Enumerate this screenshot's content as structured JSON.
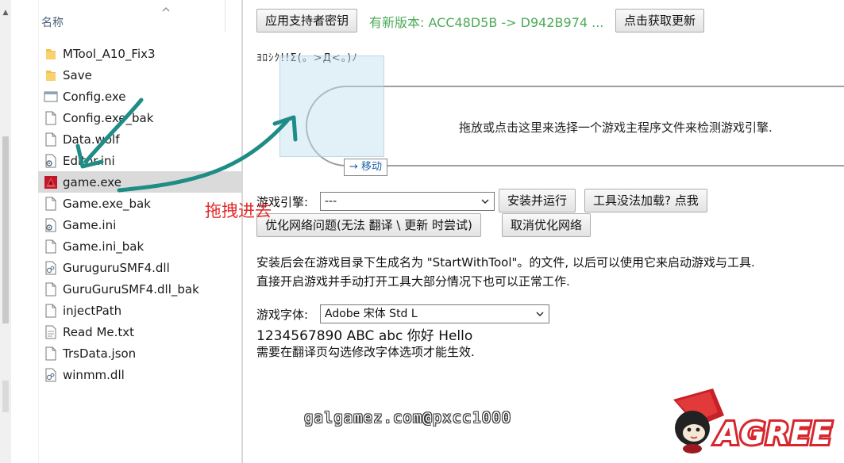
{
  "explorer": {
    "column_header": "名称",
    "files": [
      {
        "name": "MTool_A10_Fix3",
        "icon": "folder-icon"
      },
      {
        "name": "Save",
        "icon": "folder-icon"
      },
      {
        "name": "Config.exe",
        "icon": "app-window-icon"
      },
      {
        "name": "Config.exe_bak",
        "icon": "file-icon"
      },
      {
        "name": "Data.wolf",
        "icon": "file-icon"
      },
      {
        "name": "Editor.ini",
        "icon": "settings-file-icon"
      },
      {
        "name": "game.exe",
        "icon": "game-exe-icon",
        "selected": true
      },
      {
        "name": "Game.exe_bak",
        "icon": "file-icon"
      },
      {
        "name": "Game.ini",
        "icon": "settings-file-icon"
      },
      {
        "name": "Game.ini_bak",
        "icon": "file-icon"
      },
      {
        "name": "GuruguruSMF4.dll",
        "icon": "dll-icon"
      },
      {
        "name": "GuruGuruSMF4.dll_bak",
        "icon": "file-icon"
      },
      {
        "name": "injectPath",
        "icon": "file-icon"
      },
      {
        "name": "Read Me.txt",
        "icon": "text-file-icon"
      },
      {
        "name": "TrsData.json",
        "icon": "file-icon"
      },
      {
        "name": "winmm.dll",
        "icon": "dll-icon"
      }
    ]
  },
  "app": {
    "apply_key_button": "应用支持者密钥",
    "update_text": "有新版本: ACC48D5B -> D942B974 ...",
    "get_update_button": "点击获取更新",
    "kaomoji": "ﾖﾛｼｸ!!Σ(。>Д<。)ﾉ",
    "drop_zone_text": "拖放或点击这里来选择一个游戏主程序文件来检测游戏引擎.",
    "move_tooltip": "→ 移动",
    "engine_label": "游戏引擎:",
    "engine_value": "---",
    "install_run_button": "安装并运行",
    "tool_not_loaded_button": "工具没法加载? 点我",
    "optimize_network_button": "优化网络问题(无法 翻译 \\ 更新 时尝试)",
    "cancel_optimize_button": "取消优化网络",
    "info_line1": "安装后会在游戏目录下生成名为 \"StartWithTool\"。的文件, 以后可以使用它来启动游戏与工具.",
    "info_line2": "直接开启游戏并手动打开工具大部分情况下也可以正常工作.",
    "font_label": "游戏字体:",
    "font_value": "Adobe 宋体 Std L",
    "font_preview": "1234567890 ABC abc 你好 Hello",
    "font_note": "需要在翻译页勾选修改字体选项才能生效."
  },
  "annotation": {
    "text": "拖拽进去",
    "color": "#e22b2b",
    "arrow_color": "#1f8c86"
  },
  "watermark": {
    "text": "galgamez.com@pxcc1000",
    "logo_text": "AGREE"
  },
  "colors": {
    "update_green": "#4cab57",
    "selection_gray": "#dadada"
  }
}
